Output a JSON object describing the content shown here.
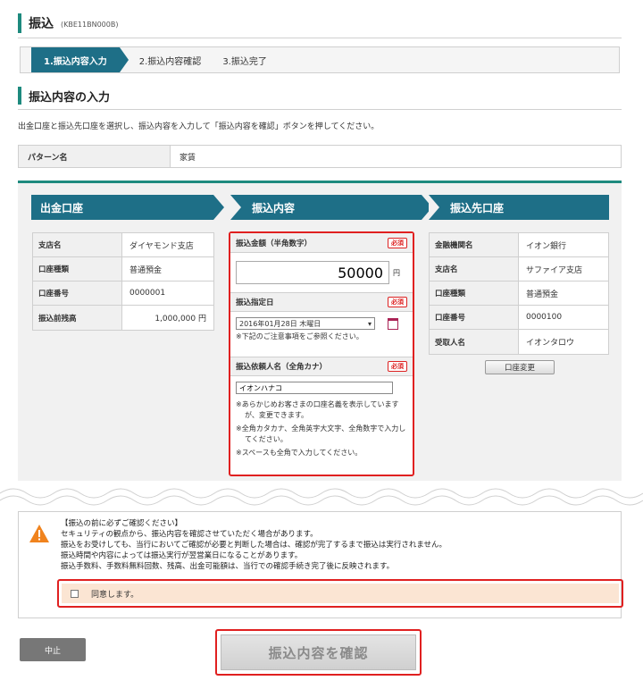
{
  "header": {
    "title": "振込",
    "code": "(KBE11BN000B)"
  },
  "steps": [
    {
      "label": "1.振込内容入力"
    },
    {
      "label": "2.振込内容確認"
    },
    {
      "label": "3.振込完了"
    }
  ],
  "section": {
    "title": "振込内容の入力"
  },
  "instruction": "出金口座と振込先口座を選択し、振込内容を入力して「振込内容を確認」ボタンを押してください。",
  "pattern": {
    "label": "パターン名",
    "value": "家賃"
  },
  "columns": {
    "source": "出金口座",
    "content": "振込内容",
    "destination": "振込先口座"
  },
  "source_account": {
    "rows": [
      {
        "label": "支店名",
        "value": "ダイヤモンド支店"
      },
      {
        "label": "口座種類",
        "value": "普通預金"
      },
      {
        "label": "口座番号",
        "value": "0000001"
      },
      {
        "label": "振込前残高",
        "value": "1,000,000 円"
      }
    ]
  },
  "transfer": {
    "required_badge": "必須",
    "amount_label": "振込金額（半角数字）",
    "amount_value": "50000",
    "amount_unit": "円",
    "date_label": "振込指定日",
    "date_value": "2016年01月28日 木曜日",
    "date_note": "※下記のご注意事項をご参照ください。",
    "name_label": "振込依頼人名（全角カナ）",
    "name_value": "イオンハナコ",
    "notes": [
      "※あらかじめお客さまの口座名義を表示していますが、変更できます。",
      "※全角カタカナ、全角英字大文字、全角数字で入力してください。",
      "※スペースも全角で入力してください。"
    ]
  },
  "destination_account": {
    "rows": [
      {
        "label": "金融機関名",
        "value": "イオン銀行"
      },
      {
        "label": "支店名",
        "value": "サファイア支店"
      },
      {
        "label": "口座種類",
        "value": "普通預金"
      },
      {
        "label": "口座番号",
        "value": "0000100"
      },
      {
        "label": "受取人名",
        "value": "イオンタロウ"
      }
    ],
    "change_button": "口座変更"
  },
  "confirmation": {
    "lines": [
      "【振込の前に必ずご確認ください】",
      "セキュリティの観点から、振込内容を確認させていただく場合があります。",
      "振込をお受けしても、当行においてご確認が必要と判断した場合は、確認が完了するまで振込は実行されません。",
      "振込時間や内容によっては振込実行が翌営業日になることがあります。",
      "振込手数料、手数料無料回数、残高、出金可能額は、当行での確認手続き完了後に反映されます。"
    ],
    "agree_label": "同意します。"
  },
  "buttons": {
    "cancel": "中止",
    "confirm": "振込内容を確認"
  }
}
